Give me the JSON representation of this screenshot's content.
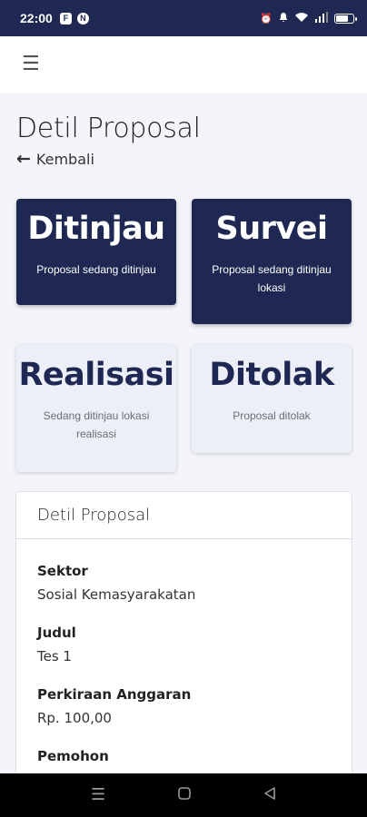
{
  "status_bar": {
    "time": "22:00",
    "app_icon_1": "F",
    "app_icon_2": "N",
    "icons": [
      "alarm-icon",
      "vibrate-icon",
      "wifi-icon",
      "signal-icon",
      "battery-icon"
    ],
    "battery_level": 0.7
  },
  "appbar": {
    "menu_icon": "hamburger-menu-icon"
  },
  "page": {
    "title": "Detil Proposal",
    "back_label": "Kembali"
  },
  "status_cards": [
    {
      "title": "Ditinjau",
      "subtitle": "Proposal sedang ditinjau",
      "active": true
    },
    {
      "title": "Survei",
      "subtitle": "Proposal sedang ditinjau lokasi",
      "active": true
    },
    {
      "title": "Realisasi",
      "subtitle": "Sedang ditinjau lokasi realisasi",
      "active": false
    },
    {
      "title": "Ditolak",
      "subtitle": "Proposal ditolak",
      "active": false
    }
  ],
  "detail": {
    "header": "Detil Proposal",
    "fields": [
      {
        "label": "Sektor",
        "value": "Sosial Kemasyarakatan"
      },
      {
        "label": "Judul",
        "value": "Tes 1"
      },
      {
        "label": "Perkiraan Anggaran",
        "value": "Rp. 100,00"
      },
      {
        "label": "Pemohon",
        "value": ""
      }
    ]
  },
  "colors": {
    "primary": "#1e2852",
    "card_light": "#eceff7",
    "background": "#f3f5fa"
  }
}
